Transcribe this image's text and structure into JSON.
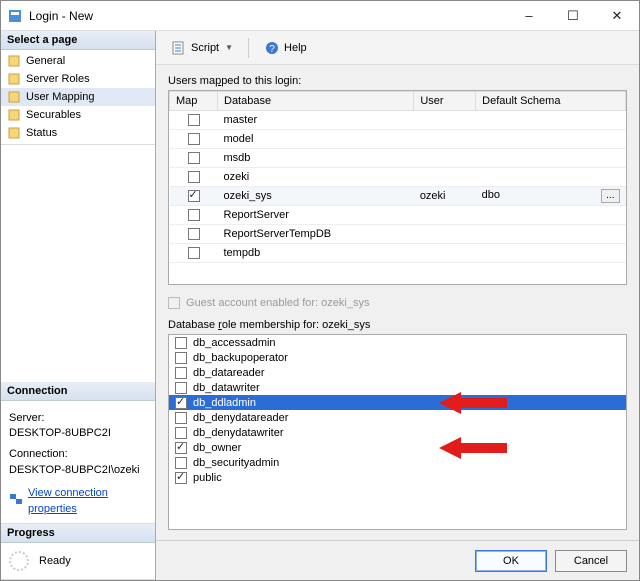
{
  "window": {
    "title": "Login - New"
  },
  "sidebar": {
    "select_page": "Select a page",
    "pages": [
      {
        "label": "General"
      },
      {
        "label": "Server Roles"
      },
      {
        "label": "User Mapping"
      },
      {
        "label": "Securables"
      },
      {
        "label": "Status"
      }
    ],
    "connection_hdr": "Connection",
    "server_lbl": "Server:",
    "server_val": "DESKTOP-8UBPC2I",
    "conn_lbl": "Connection:",
    "conn_val": "DESKTOP-8UBPC2I\\ozeki",
    "view_conn": "View connection properties",
    "progress_hdr": "Progress",
    "progress_status": "Ready"
  },
  "toolbar": {
    "script": "Script",
    "help": "Help"
  },
  "mapping": {
    "label_pre": "Users ma",
    "label_ul": "p",
    "label_post": "ped to this login:",
    "cols": {
      "map": "Map",
      "db": "Database",
      "user": "User",
      "schema": "Default Schema"
    },
    "rows": [
      {
        "checked": false,
        "db": "master",
        "user": "",
        "schema": ""
      },
      {
        "checked": false,
        "db": "model",
        "user": "",
        "schema": ""
      },
      {
        "checked": false,
        "db": "msdb",
        "user": "",
        "schema": ""
      },
      {
        "checked": false,
        "db": "ozeki",
        "user": "",
        "schema": ""
      },
      {
        "checked": true,
        "db": "ozeki_sys",
        "user": "ozeki",
        "schema": "dbo"
      },
      {
        "checked": false,
        "db": "ReportServer",
        "user": "",
        "schema": ""
      },
      {
        "checked": false,
        "db": "ReportServerTempDB",
        "user": "",
        "schema": ""
      },
      {
        "checked": false,
        "db": "tempdb",
        "user": "",
        "schema": ""
      }
    ]
  },
  "guest": {
    "label_pre": "",
    "label_ul": "G",
    "label_post": "uest account enabled for: ozeki_sys"
  },
  "roles": {
    "label_pre": "Database ",
    "label_ul": "r",
    "label_post": "ole membership for: ozeki_sys",
    "items": [
      {
        "name": "db_accessadmin",
        "checked": false,
        "hl": false
      },
      {
        "name": "db_backupoperator",
        "checked": false,
        "hl": false
      },
      {
        "name": "db_datareader",
        "checked": false,
        "hl": false
      },
      {
        "name": "db_datawriter",
        "checked": false,
        "hl": false
      },
      {
        "name": "db_ddladmin",
        "checked": true,
        "hl": true
      },
      {
        "name": "db_denydatareader",
        "checked": false,
        "hl": false
      },
      {
        "name": "db_denydatawriter",
        "checked": false,
        "hl": false
      },
      {
        "name": "db_owner",
        "checked": true,
        "hl": false
      },
      {
        "name": "db_securityadmin",
        "checked": false,
        "hl": false
      },
      {
        "name": "public",
        "checked": true,
        "hl": false
      }
    ]
  },
  "footer": {
    "ok": "OK",
    "cancel": "Cancel"
  },
  "colors": {
    "accent": "#2b6cd6"
  }
}
